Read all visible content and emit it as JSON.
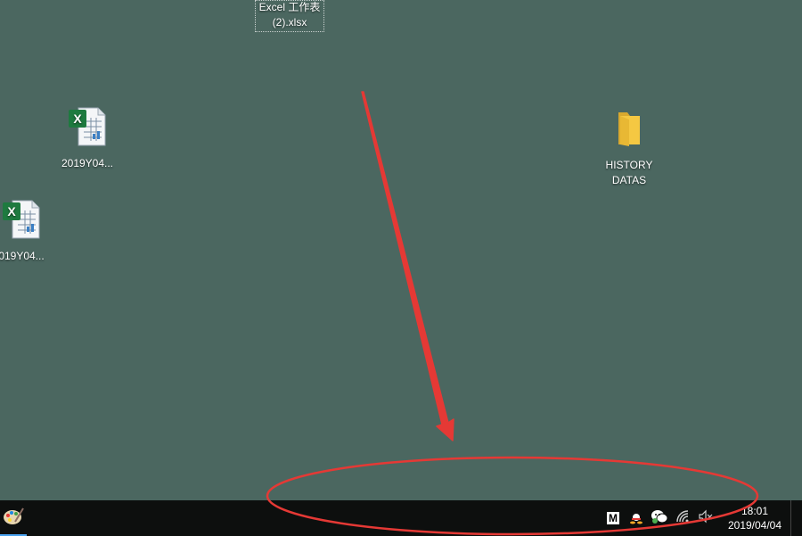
{
  "desktop": {
    "background_color": "#4b6760",
    "icons": [
      {
        "name": "excel-file",
        "line1": "Excel 工作表",
        "line2": "(2).xlsx"
      },
      {
        "name": "xlsx-file",
        "label": "2019Y04..."
      },
      {
        "name": "xlsx-file",
        "label": "019Y04..."
      },
      {
        "name": "folder",
        "line1": "HISTORY",
        "line2": "DATAS"
      }
    ]
  },
  "taskbar": {
    "background_color": "#0d0f0e",
    "tray_icons": [
      "m-app-icon",
      "qq-icon",
      "wechat-icon",
      "wifi-icon",
      "volume-muted-icon"
    ],
    "m_label": "M",
    "clock": {
      "time": "18:01",
      "date": "2019/04/04"
    }
  },
  "annotation": {
    "color": "#e53935",
    "shapes": [
      "arrow",
      "ellipse"
    ]
  }
}
